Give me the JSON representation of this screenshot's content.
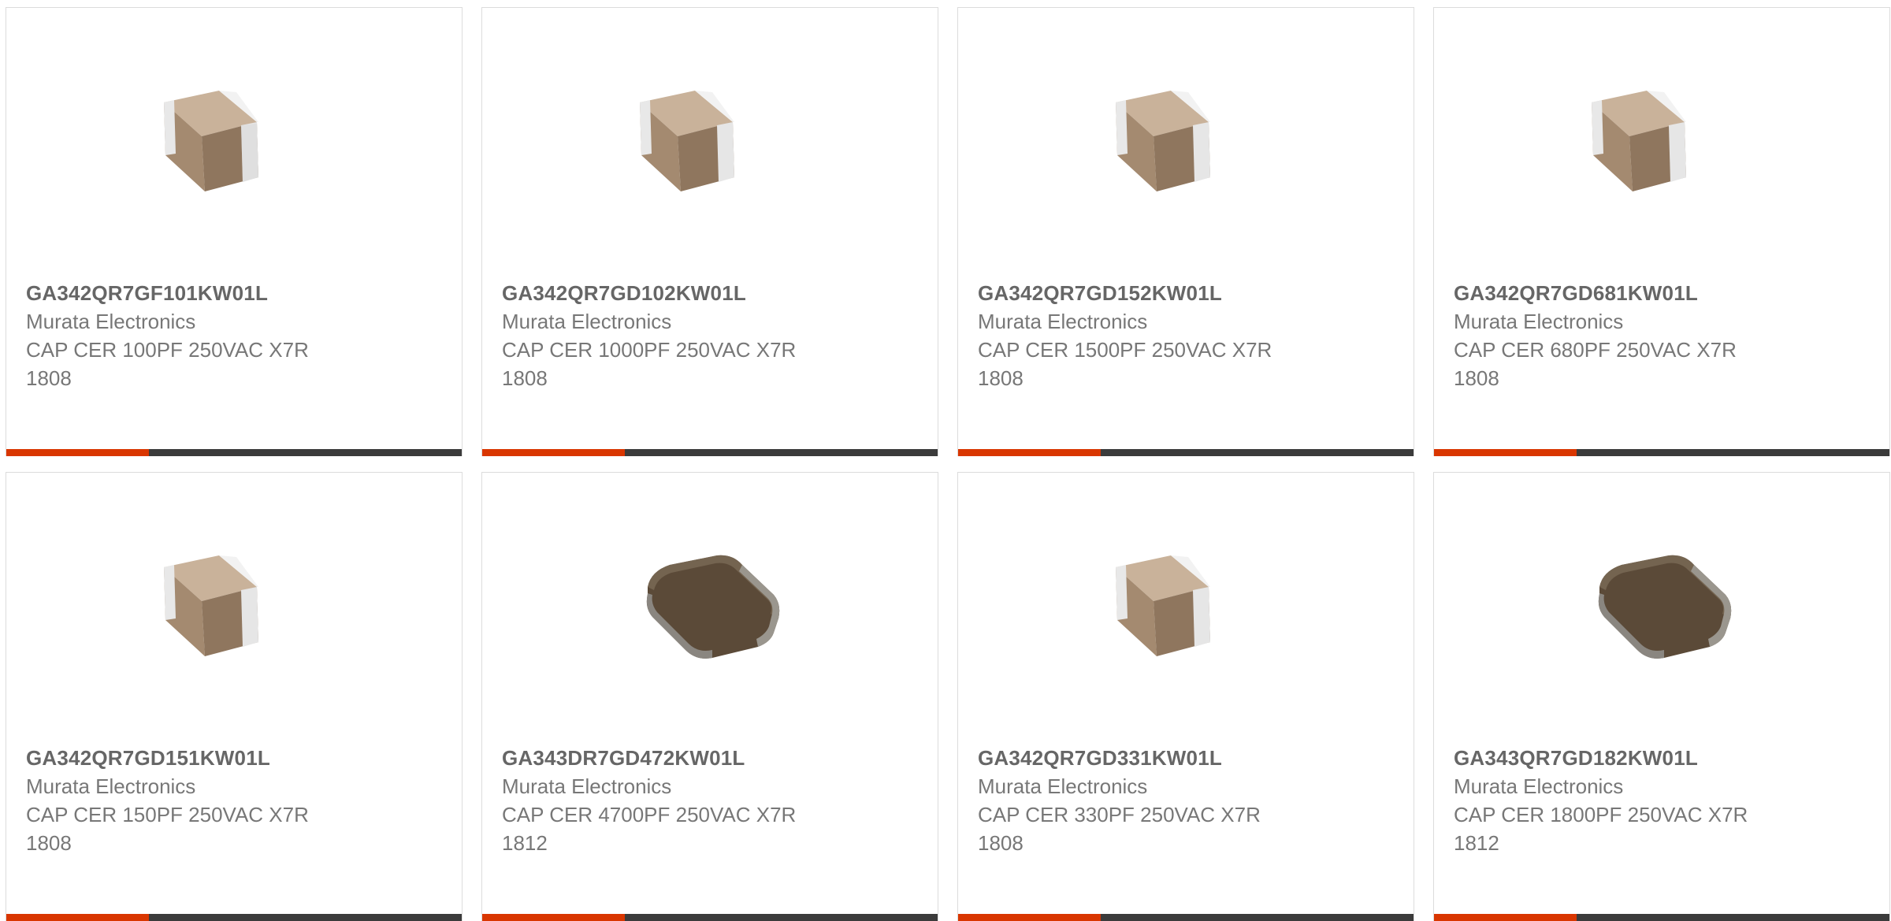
{
  "products": [
    {
      "part_number": "GA342QR7GF101KW01L",
      "manufacturer": "Murata Electronics",
      "description": "CAP CER 100PF 250VAC X7R",
      "package": "1808",
      "image": "mlcc-light-tan"
    },
    {
      "part_number": "GA342QR7GD102KW01L",
      "manufacturer": "Murata Electronics",
      "description": "CAP CER 1000PF 250VAC X7R",
      "package": "1808",
      "image": "mlcc-light-tan"
    },
    {
      "part_number": "GA342QR7GD152KW01L",
      "manufacturer": "Murata Electronics",
      "description": "CAP CER 1500PF 250VAC X7R",
      "package": "1808",
      "image": "mlcc-light-tan"
    },
    {
      "part_number": "GA342QR7GD681KW01L",
      "manufacturer": "Murata Electronics",
      "description": "CAP CER 680PF 250VAC X7R",
      "package": "1808",
      "image": "mlcc-light-tan"
    },
    {
      "part_number": "GA342QR7GD151KW01L",
      "manufacturer": "Murata Electronics",
      "description": "CAP CER 150PF 250VAC X7R",
      "package": "1808",
      "image": "mlcc-light-tan"
    },
    {
      "part_number": "GA343DR7GD472KW01L",
      "manufacturer": "Murata Electronics",
      "description": "CAP CER 4700PF 250VAC X7R",
      "package": "1812",
      "image": "mlcc-dark-brown"
    },
    {
      "part_number": "GA342QR7GD331KW01L",
      "manufacturer": "Murata Electronics",
      "description": "CAP CER 330PF 250VAC X7R",
      "package": "1808",
      "image": "mlcc-light-tan"
    },
    {
      "part_number": "GA343QR7GD182KW01L",
      "manufacturer": "Murata Electronics",
      "description": "CAP CER 1800PF 250VAC X7R",
      "package": "1812",
      "image": "mlcc-dark-brown"
    }
  ],
  "colors": {
    "accent": "#d93600",
    "bar": "#3b3b3b",
    "part_number_text": "#666666",
    "body_text": "#777777",
    "card_border": "#dcdcdc"
  }
}
